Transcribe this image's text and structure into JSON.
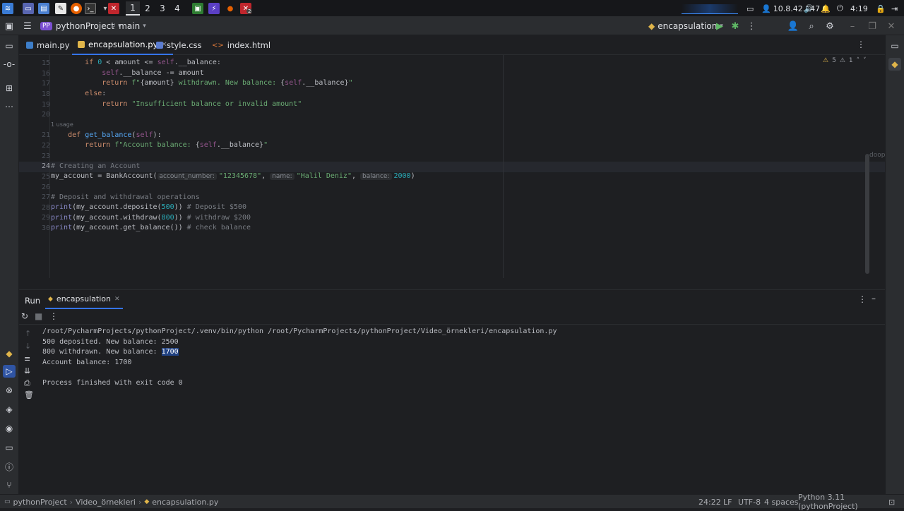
{
  "taskbar": {
    "workspaces": [
      "1",
      "2",
      "3",
      "4"
    ],
    "ip": "10.8.42.147",
    "time": "4:19",
    "notif_count": "2"
  },
  "toolbar": {
    "project_badge": "PP",
    "project": "pythonProject",
    "branch": "main",
    "run_config": "encapsulation"
  },
  "tabs": [
    {
      "label": "main.py"
    },
    {
      "label": "encapsulation.py"
    },
    {
      "label": "style.css"
    },
    {
      "label": "index.html"
    }
  ],
  "editor": {
    "inspections": {
      "warnings": "5",
      "weak": "1"
    },
    "line_numbers": [
      "15",
      "16",
      "17",
      "18",
      "19",
      "20",
      "21",
      "22",
      "23",
      "24",
      "25",
      "26",
      "27",
      "28",
      "29",
      "30"
    ],
    "usage_hint": "1 usage",
    "hints": {
      "account_number": "account_number:",
      "name": "name:",
      "balance": "balance:"
    },
    "side_label": "doop"
  },
  "run": {
    "tab_title": "Run",
    "config_tab": "encapsulation",
    "output": [
      "/root/PycharmProjects/pythonProject/.venv/bin/python /root/PycharmProjects/pythonProject/Video_örnekleri/encapsulation.py",
      "500 deposited. New balance: 2500",
      "800 withdrawn. New balance: ",
      "1700",
      "Account balance: 1700",
      "Process finished with exit code 0"
    ]
  },
  "status": {
    "breadcrumb": [
      "pythonProject",
      "Video_örnekleri",
      "encapsulation.py"
    ],
    "position": "24:22",
    "line_sep": "LF",
    "encoding": "UTF-8",
    "indent": "4 spaces",
    "interpreter": "Python 3.11 (pythonProject)"
  },
  "colors": {
    "accent": "#3574f0",
    "bg": "#1e1f22",
    "panel": "#2b2d30",
    "selection": "#214283"
  }
}
